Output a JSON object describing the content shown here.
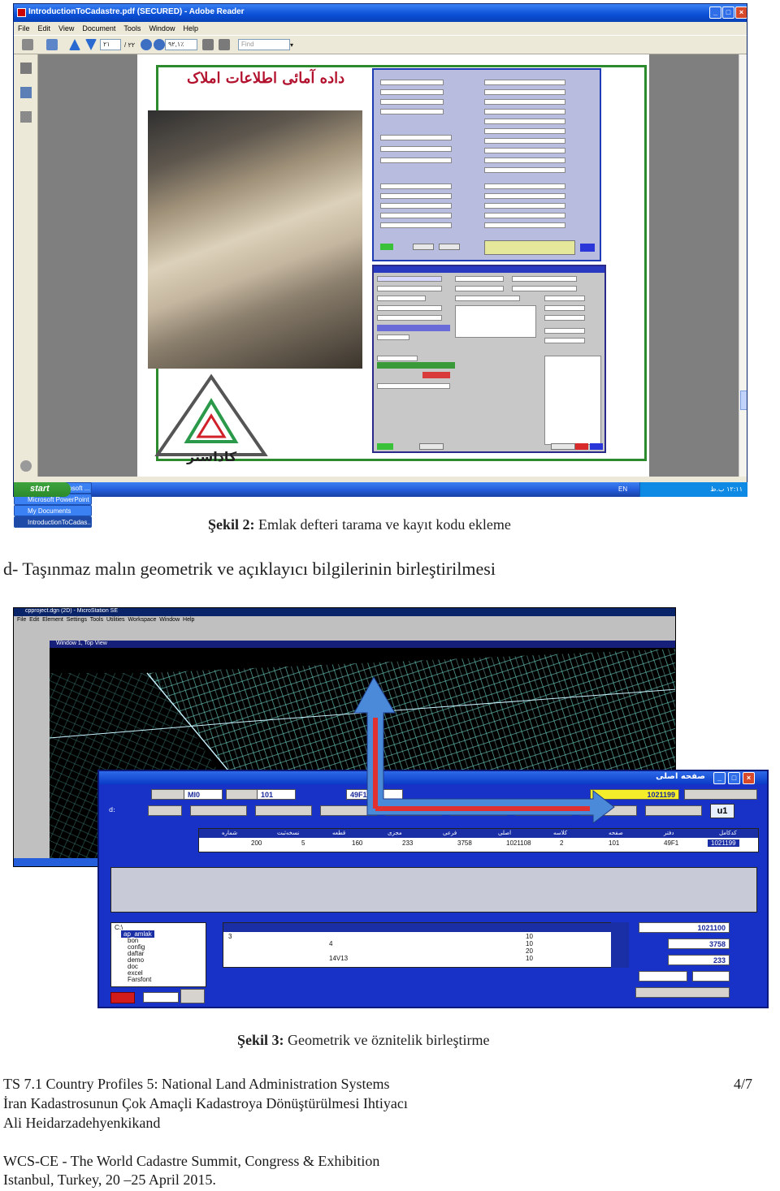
{
  "figure2": {
    "window_title": "IntroductionToCadastre.pdf (SECURED) - Adobe Reader",
    "menu": [
      "File",
      "Edit",
      "View",
      "Document",
      "Tools",
      "Window",
      "Help"
    ],
    "page_current": "٢١",
    "page_total": "/ ٢٢",
    "zoom": "٩٢,١٪",
    "find_placeholder": "Find",
    "slide_title": "داده آمائی اطلاعات املاک",
    "logo_text": "کاداستر",
    "taskbar": {
      "start": "start",
      "tasks": [
        "hh.docx - Microsoft ...",
        "Microsoft PowerPoint ...",
        "My Documents",
        "IntroductionToCadas..."
      ],
      "lang": "EN",
      "clock": "١٢:١١ ب.ظ"
    }
  },
  "caption2": {
    "label": "Şekil 2:",
    "text": " Emlak defteri tarama ve kayıt kodu ekleme"
  },
  "section_heading": "d- Taşınmaz malın geometrik ve açıklayıcı bilgilerinin birleştirilmesi",
  "figure3": {
    "window_title": "cpproject.dgn (2D) - MicroStation SE",
    "menu": [
      "File",
      "Edit",
      "Element",
      "Settings",
      "Tools",
      "Utilities",
      "Workspace",
      "Window",
      "Help"
    ],
    "view_title": "Window 1, Top View",
    "form": {
      "title": "صفحه اصلی",
      "fields_top": [
        "1021199",
        "49F1",
        "101",
        "MI0"
      ],
      "u1": "u1",
      "d_label": "d:",
      "main_table": {
        "headers": [
          "کدکامل",
          "دفتر",
          "صفحه",
          "کلاسه",
          "اصلی",
          "فرعی",
          "مجزی",
          "قطعه",
          "نسخه‌ثبت",
          "شماره"
        ],
        "row": [
          "1021199",
          "49F1",
          "101",
          "2",
          "1021108",
          "3758",
          "233",
          "160",
          "5",
          "200"
        ]
      },
      "folders": [
        "C:\\",
        "ap_amlak",
        "bon",
        "config",
        "daftar",
        "demo",
        "doc",
        "excel",
        "Farsfont"
      ],
      "lower_table_rows": [
        [
          "10",
          "",
          "",
          "",
          "",
          "3"
        ],
        [
          "10",
          "",
          "",
          "4",
          "",
          ""
        ],
        [
          "20",
          "",
          "",
          "",
          "",
          ""
        ],
        [
          "10",
          "",
          "",
          "14V13",
          "",
          ""
        ]
      ],
      "right_values": [
        "1021100",
        "3758",
        "233"
      ]
    }
  },
  "caption3": {
    "label": "Şekil 3:",
    "text": " Geometrik ve öznitelik birleştirme"
  },
  "footer": {
    "line1": "TS 7.1 Country Profiles 5: National Land Administration Systems",
    "page": "4/7",
    "line2": "İran Kadastrosunun Çok Amaçli Kadastroya Dönüştürülmesi Ihtiyacı",
    "line3": "Ali Heidarzadehyenkikand",
    "line4": "WCS-CE - The World Cadastre Summit, Congress & Exhibition",
    "line5": "Istanbul, Turkey, 20 –25 April 2015."
  }
}
